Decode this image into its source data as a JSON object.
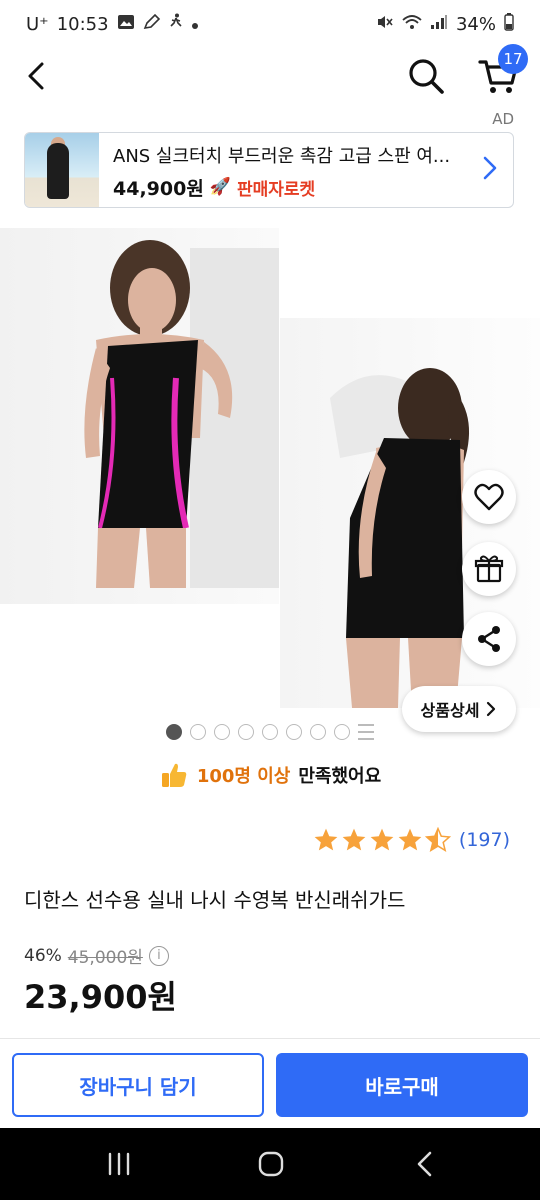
{
  "status_bar": {
    "carrier": "U⁺",
    "time": "10:53",
    "battery": "34%",
    "icons": [
      "gallery-icon",
      "pen-icon",
      "walking-icon",
      "dot-icon",
      "mute-icon",
      "wifi-icon",
      "signal-icon",
      "battery-icon"
    ]
  },
  "nav": {
    "cart_count": "17",
    "icons": [
      "back-arrow-icon",
      "search-icon",
      "cart-icon"
    ]
  },
  "ad": {
    "label": "AD",
    "title": "ANS 실크터치 부드러운 촉감 고급 스판 여...",
    "price": "44,900원",
    "seller": "판매자로켓",
    "rocket_icon": "🚀"
  },
  "gallery": {
    "detail_button": "상품상세",
    "total_dots": 8,
    "active_dot": 0,
    "icons": [
      "heart-icon",
      "gift-icon",
      "share-icon",
      "chevron-right-icon",
      "grid-more-icon"
    ]
  },
  "satisfaction": {
    "count_text": "100명 이상",
    "suffix": "만족했어요"
  },
  "rating": {
    "stars": 4.5,
    "review_count": "(197)"
  },
  "product": {
    "title": "디한스 선수용 실내 나시 수영복 반신래쉬가드",
    "discount": "46%",
    "original_price": "45,000원",
    "sale_price": "23,900원",
    "info_icon": "i"
  },
  "actions": {
    "add_to_cart": "장바구니 담기",
    "buy_now": "바로구매"
  },
  "colors": {
    "accent": "#2f6bf6",
    "rocket": "#e53d23",
    "star": "#f7a23b",
    "satisfaction": "#e0720c",
    "review_link": "#3466d8"
  }
}
